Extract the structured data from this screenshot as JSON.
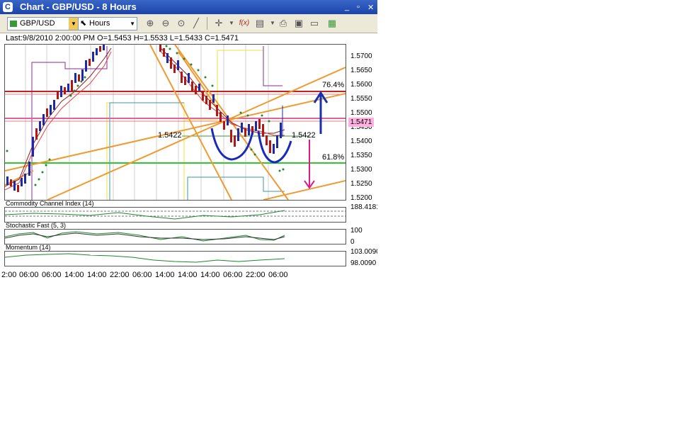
{
  "window": {
    "title": "Chart - GBP/USD - 8 Hours"
  },
  "toolbar": {
    "symbol": "GBP/USD",
    "period": "Hours"
  },
  "info_line": "Last:9/8/2010 2:00:00 PM O=1.5453 H=1.5533 L=1.5433 C=1.5471",
  "price_axis": [
    "1.5700",
    "1.5650",
    "1.5600",
    "1.5550",
    "1.5500",
    "1.5450",
    "1.5400",
    "1.5350",
    "1.5300",
    "1.5250",
    "1.5200"
  ],
  "last_price": "1.5471",
  "annotations": {
    "fib_764": "76.4%",
    "fib_618": "61.8%",
    "neck_left": "1.5422",
    "neck_right": "1.5422"
  },
  "indicators": {
    "cci": {
      "label": "Commodity Channel Index (14)",
      "value": "188.4181"
    },
    "stoch": {
      "label": "Stochastic Fast (5, 3)",
      "top": "100",
      "bottom": "0"
    },
    "momentum": {
      "label": "Momentum (14)",
      "top": "103.0090",
      "bottom": "98.0090"
    }
  },
  "time_axis": [
    "2:00",
    "06:00",
    "06:00",
    "14:00",
    "14:00",
    "22:00",
    "06:00",
    "14:00",
    "14:00",
    "14:00",
    "06:00",
    "22:00",
    "06:00"
  ],
  "colors": {
    "up_candle": "#1a2aa8",
    "down_candle": "#b01818",
    "orange": "#f09a30",
    "green": "#30c830",
    "red": "#c82020",
    "pink": "#e070b0",
    "arrow_blue": "#1830b0",
    "arrow_magenta": "#e01890"
  }
}
